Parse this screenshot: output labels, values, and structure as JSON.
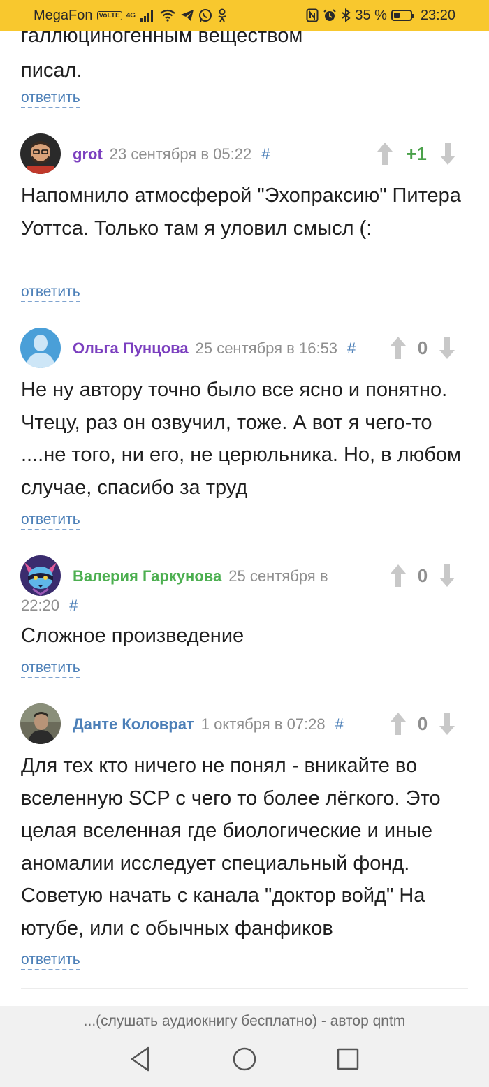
{
  "status_bar": {
    "carrier": "MegaFon",
    "volte": "VoLTE",
    "network": "4G",
    "battery_percent": "35 %",
    "battery_level": 0.35,
    "time": "23:20"
  },
  "previous_comment": {
    "text_lines": [
      "галлюциногенным веществом",
      "писал."
    ],
    "reply_label": "ответить"
  },
  "comments": [
    {
      "author": "grot",
      "author_color": "#7b3fbf",
      "date": "23 сентября в 05:22",
      "hash": "#",
      "score": "+1",
      "text": "Напомнило атмосферой \"Эхопраксию\" Питера Уоттса. Только там я уловил смысл (:",
      "reply_label": "ответить",
      "avatar_icon": "bearded-man-avatar"
    },
    {
      "author": "Ольга Пунцова",
      "author_color": "#7b3fbf",
      "date": "25 сентября в 16:53",
      "hash": "#",
      "score": "0",
      "text": "Не ну автору точно было все ясно и понятно. Чтецу, раз он озвучил, тоже. А вот я чего-то ....не того, ни его, не церюльника. Но, в любом случае, спасибо за труд",
      "reply_label": "ответить",
      "avatar_icon": "default-user-avatar"
    },
    {
      "author": "Валерия Гаркунова",
      "author_color": "#4caf50",
      "date_part1": "25 сентября в",
      "date_part2": "22:20",
      "hash": "#",
      "score": "0",
      "text": "Сложное произведение",
      "reply_label": "ответить",
      "avatar_icon": "raccoon-avatar"
    },
    {
      "author": "Данте Коловрат",
      "author_color": "#4d80b8",
      "date": "1 октября в 07:28",
      "hash": "#",
      "score": "0",
      "text": "Для тех кто ничего не понял - вникайте во вселенную SCP с чего то более лёгкого. Это целая вселенная где биологические и иные аномалии исследует специальный фонд. Советую начать с канала \"доктор войд\" На ютубе, или с обычных фанфиков",
      "reply_label": "ответить",
      "avatar_icon": "photo-avatar"
    }
  ],
  "browser": {
    "page_title": "...(слушать аудиокнигу бесплатно) - автор qntm"
  },
  "navigation": {
    "back": "back-icon",
    "home": "home-icon",
    "recents": "recents-icon"
  }
}
